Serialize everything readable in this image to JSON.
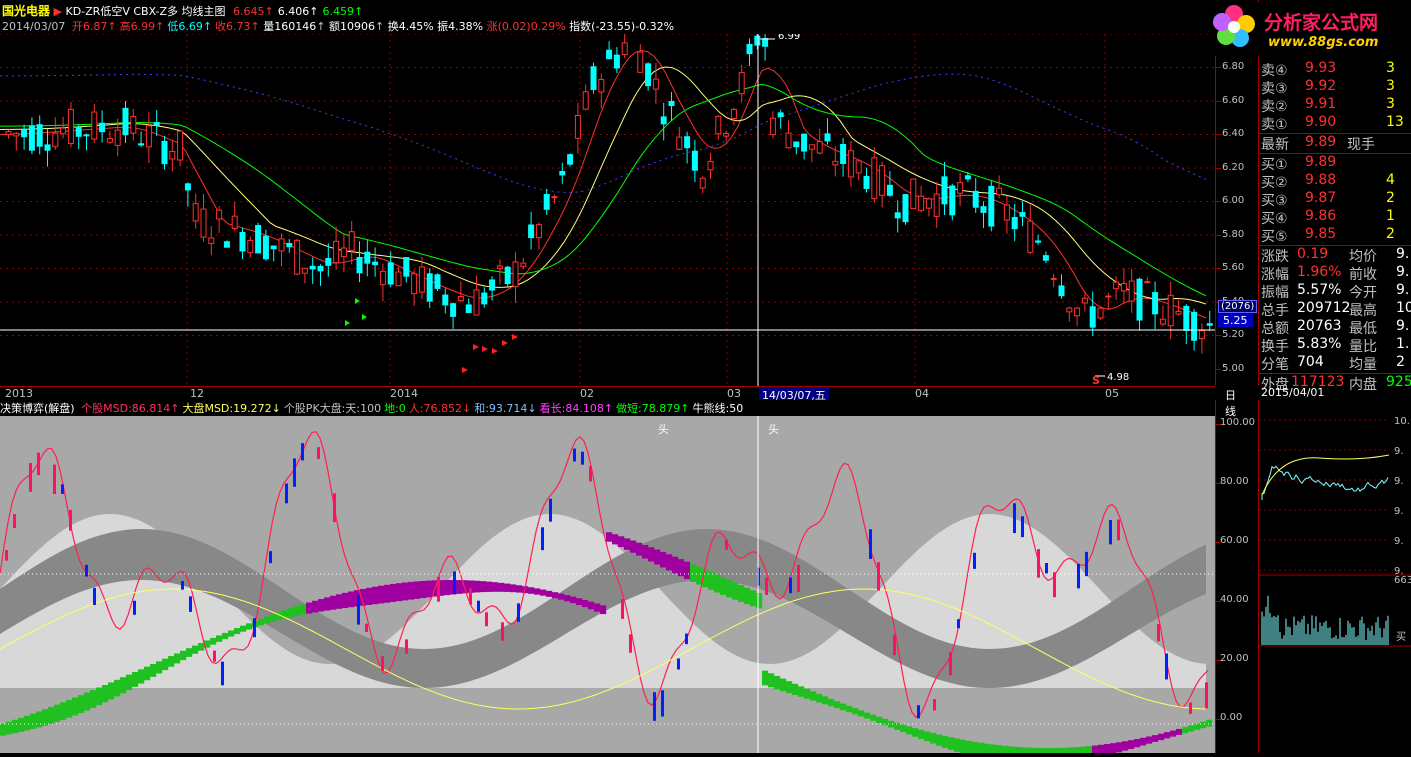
{
  "header": {
    "stock_name": "国光电器",
    "formula_line": "KD-ZR低空V CBX-Z多 均线主图",
    "ma_values": [
      {
        "text": "6.645↑",
        "color": "#ff3030"
      },
      {
        "text": "6.406↑",
        "color": "#ffffff"
      },
      {
        "text": "6.459↑",
        "color": "#00ff00"
      }
    ],
    "date": "2014/03/07",
    "ohlc": [
      {
        "label": "开",
        "value": "6.87",
        "color": "#ff3030"
      },
      {
        "label": "高",
        "value": "6.99",
        "color": "#ff3030"
      },
      {
        "label": "低",
        "value": "6.69",
        "color": "#00ffff"
      },
      {
        "label": "收",
        "value": "6.73",
        "color": "#ff3030"
      }
    ],
    "volume": "量160146",
    "amount": "额10906",
    "turnover": "换4.45%",
    "amplitude": "振4.38%",
    "change": "涨(0.02)0.29%",
    "index_change": "指数(-23.55)-0.32%"
  },
  "price_axis": {
    "ticks": [
      "6.80",
      "6.60",
      "6.40",
      "6.20",
      "6.00",
      "5.80",
      "5.60",
      "5.40",
      "5.20",
      "5.00"
    ],
    "cursor_label": "(2076)",
    "cursor_price": "5.25",
    "high_label": "6.99",
    "low_label": "4.98",
    "signal_s": "S"
  },
  "date_axis": {
    "labels": [
      "2013",
      "12",
      "2014",
      "02",
      "03",
      "04",
      "05"
    ],
    "cursor_date": "14/03/07,五",
    "daily_label": "日线"
  },
  "indicator": {
    "name": "决策博弈(解盘)",
    "items": [
      {
        "text": "个股MSD:86.814↑",
        "color": "#ff3060"
      },
      {
        "text": "大盘MSD:19.272↓",
        "color": "#ffff60"
      },
      {
        "text": "个股PK大盘:天:100",
        "color": "#c0c0c0"
      },
      {
        "text": "地:0",
        "color": "#00ff00"
      },
      {
        "text": "人:76.852↓",
        "color": "#ff3030"
      },
      {
        "text": "和:93.714↓",
        "color": "#80c0ff"
      },
      {
        "text": "看长:84.108↑",
        "color": "#ff40ff"
      },
      {
        "text": "做短:78.879↑",
        "color": "#00ff00"
      },
      {
        "text": "牛熊线:50",
        "color": "#ffffff"
      }
    ],
    "axis_ticks": [
      "100.00",
      "80.00",
      "60.00",
      "40.00",
      "20.00",
      "0.00"
    ],
    "marker_top_1": "头",
    "marker_top_2": "头"
  },
  "quote": {
    "sell": [
      {
        "label": "卖④",
        "price": "9.93",
        "vol": "3"
      },
      {
        "label": "卖③",
        "price": "9.92",
        "vol": "3"
      },
      {
        "label": "卖②",
        "price": "9.91",
        "vol": "3"
      },
      {
        "label": "卖①",
        "price": "9.90",
        "vol": "13"
      }
    ],
    "latest_label": "最新",
    "latest_price": "9.89",
    "latest_tag": "现手",
    "buy": [
      {
        "label": "买①",
        "price": "9.89",
        "vol": ""
      },
      {
        "label": "买②",
        "price": "9.88",
        "vol": "4"
      },
      {
        "label": "买③",
        "price": "9.87",
        "vol": "2"
      },
      {
        "label": "买④",
        "price": "9.86",
        "vol": "1"
      },
      {
        "label": "买⑤",
        "price": "9.85",
        "vol": "2"
      }
    ],
    "stats": [
      {
        "l1": "涨跌",
        "v1": "0.19",
        "c1": "#ff3030",
        "l2": "均价",
        "v2": "9."
      },
      {
        "l1": "涨幅",
        "v1": "1.96%",
        "c1": "#ff3030",
        "l2": "前收",
        "v2": "9."
      },
      {
        "l1": "振幅",
        "v1": "5.57%",
        "c1": "#ffffff",
        "l2": "今开",
        "v2": "9."
      },
      {
        "l1": "总手",
        "v1": "209712",
        "c1": "#ffffff",
        "l2": "最高",
        "v2": "10."
      },
      {
        "l1": "总额",
        "v1": "20763",
        "c1": "#ffffff",
        "l2": "最低",
        "v2": "9."
      },
      {
        "l1": "换手",
        "v1": "5.83%",
        "c1": "#ffffff",
        "l2": "量比",
        "v2": "1."
      },
      {
        "l1": "分笔",
        "v1": "704",
        "c1": "#ffffff",
        "l2": "均量",
        "v2": "2"
      }
    ],
    "outer_label": "外盘",
    "outer_value": "117123",
    "inner_label": "内盘",
    "inner_value": "925"
  },
  "mini": {
    "date": "2015/04/01",
    "labels": [
      "10.",
      "9.",
      "9.",
      "9.",
      "9.",
      "9."
    ],
    "vol_label": "663",
    "tail": "买"
  },
  "logo": {
    "title": "分析家公式网",
    "url": "www.88gs.com"
  },
  "colors": {
    "up": "#ff3030",
    "down": "#00ffff",
    "grid": "#a00000"
  }
}
